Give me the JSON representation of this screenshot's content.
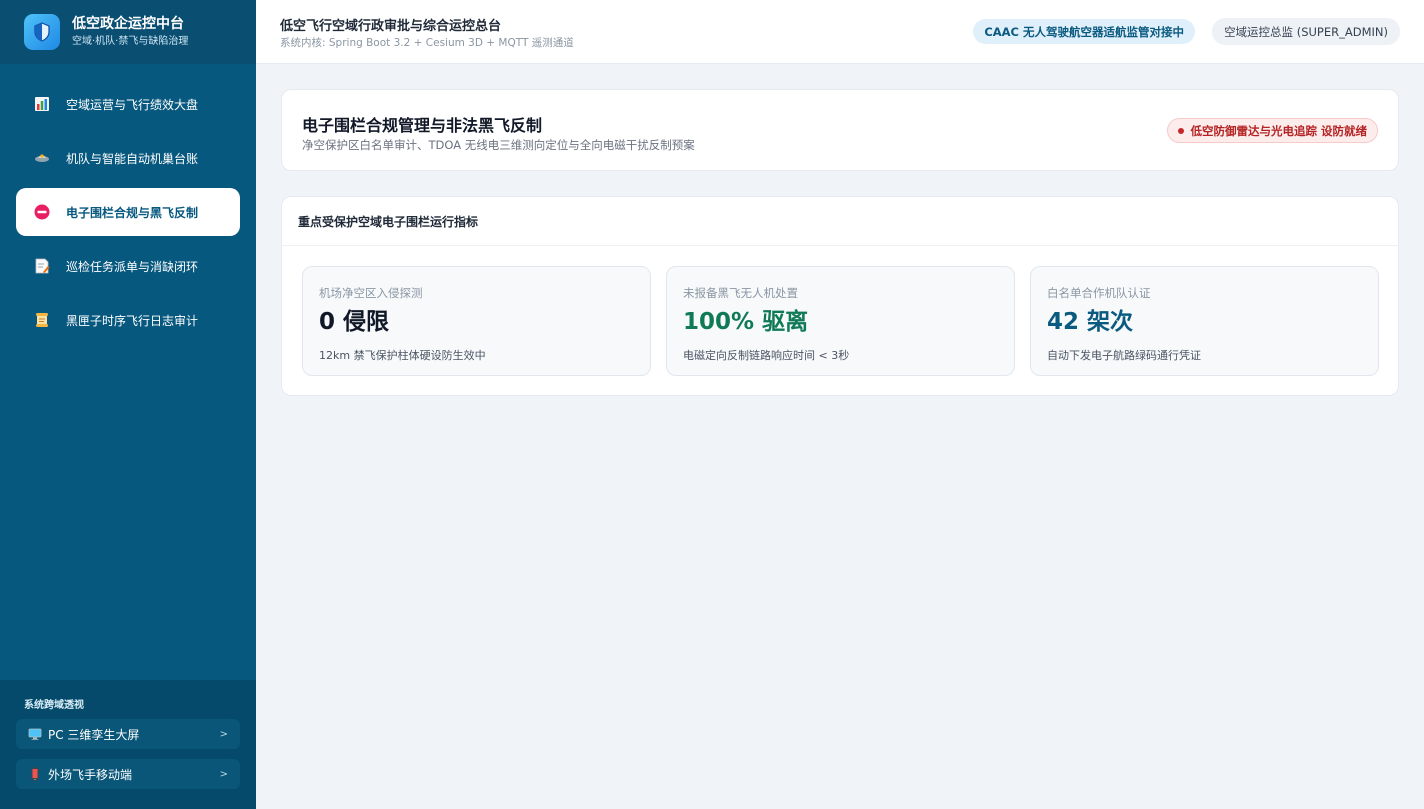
{
  "brand": {
    "title": "低空政企运控中台",
    "subtitle": "空域·机队·禁飞与缺陷治理"
  },
  "sidebar": {
    "items": [
      {
        "label": "空域运营与飞行绩效大盘",
        "icon": "bar-chart-icon",
        "active": false
      },
      {
        "label": "机队与智能自动机巢台账",
        "icon": "drone-hangar-icon",
        "active": false
      },
      {
        "label": "电子围栏合规与黑飞反制",
        "icon": "no-entry-icon",
        "active": true
      },
      {
        "label": "巡检任务派单与消缺闭环",
        "icon": "task-memo-icon",
        "active": false
      },
      {
        "label": "黑匣子时序飞行日志审计",
        "icon": "scroll-log-icon",
        "active": false
      }
    ],
    "footer": {
      "title": "系统跨域透视",
      "links": [
        {
          "label": "PC 三维孪生大屏",
          "icon": "monitor-icon",
          "chevron": ">"
        },
        {
          "label": "外场飞手移动端",
          "icon": "mobile-phone-icon",
          "chevron": ">"
        }
      ]
    }
  },
  "header": {
    "title": "低空飞行空域行政审批与综合运控总台",
    "subtitle": "系统内核: Spring Boot 3.2 + Cesium 3D + MQTT 遥测通道",
    "badge": "CAAC 无人驾驶航空器适航监管对接中",
    "user": "空域运控总监 (SUPER_ADMIN)"
  },
  "hero": {
    "title": "电子围栏合规管理与非法黑飞反制",
    "subtitle": "净空保护区白名单审计、TDOA 无线电三维测向定位与全向电磁干扰反制预案",
    "status_badge": "低空防御雷达与光电追踪 设防就绪"
  },
  "metrics": {
    "heading": "重点受保护空域电子围栏运行指标",
    "cards": [
      {
        "label": "机场净空区入侵探测",
        "value": "0 侵限",
        "note": "12km 禁飞保护柱体硬设防生效中",
        "color": "#111827"
      },
      {
        "label": "未报备黑飞无人机处置",
        "value": "100% 驱离",
        "note": "电磁定向反制链路响应时间 < 3秒",
        "color": "#0f7a55"
      },
      {
        "label": "白名单合作机队认证",
        "value": "42 架次",
        "note": "自动下发电子航路绿码通行凭证",
        "color": "#0b5a80"
      }
    ]
  }
}
